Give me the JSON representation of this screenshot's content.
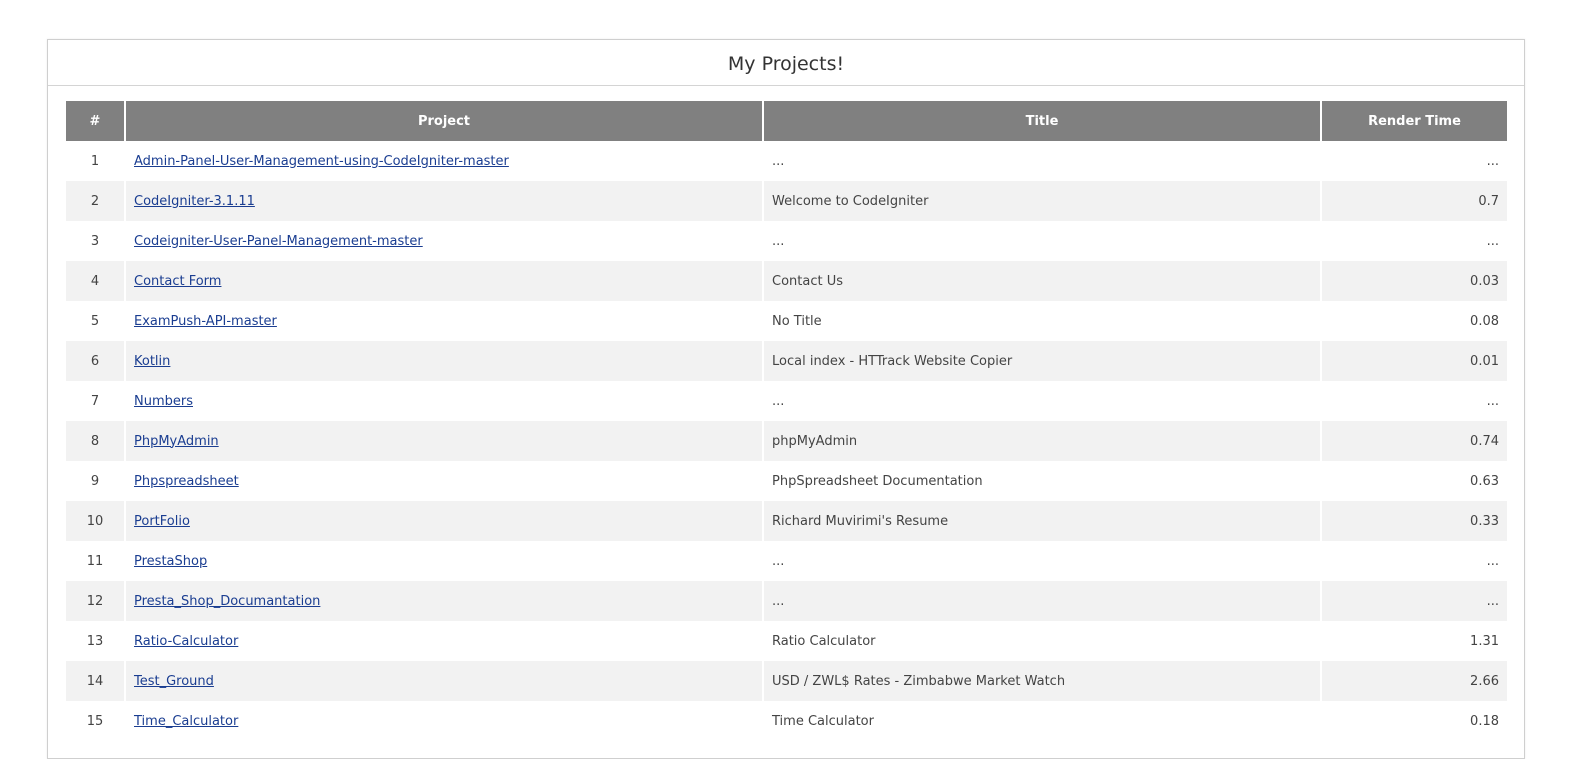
{
  "page": {
    "title": "My Projects!"
  },
  "table": {
    "headers": {
      "num": "#",
      "project": "Project",
      "title": "Title",
      "render_time": "Render Time"
    },
    "rows": [
      {
        "num": "1",
        "project": "Admin-Panel-User-Management-using-CodeIgniter-master",
        "title": "...",
        "render_time": "..."
      },
      {
        "num": "2",
        "project": "CodeIgniter-3.1.11",
        "title": "Welcome to CodeIgniter",
        "render_time": "0.7"
      },
      {
        "num": "3",
        "project": "Codeigniter-User-Panel-Management-master",
        "title": "...",
        "render_time": "..."
      },
      {
        "num": "4",
        "project": "Contact Form",
        "title": "Contact Us",
        "render_time": "0.03"
      },
      {
        "num": "5",
        "project": "ExamPush-API-master",
        "title": "No Title",
        "render_time": "0.08"
      },
      {
        "num": "6",
        "project": "Kotlin",
        "title": "Local index - HTTrack Website Copier",
        "render_time": "0.01"
      },
      {
        "num": "7",
        "project": "Numbers",
        "title": "...",
        "render_time": "..."
      },
      {
        "num": "8",
        "project": "PhpMyAdmin",
        "title": "phpMyAdmin",
        "render_time": "0.74"
      },
      {
        "num": "9",
        "project": "Phpspreadsheet",
        "title": "PhpSpreadsheet Documentation",
        "render_time": "0.63"
      },
      {
        "num": "10",
        "project": "PortFolio",
        "title": "Richard Muvirimi's Resume",
        "render_time": "0.33"
      },
      {
        "num": "11",
        "project": "PrestaShop",
        "title": "...",
        "render_time": "..."
      },
      {
        "num": "12",
        "project": "Presta_Shop_Documantation",
        "title": "...",
        "render_time": "..."
      },
      {
        "num": "13",
        "project": "Ratio-Calculator",
        "title": "Ratio Calculator",
        "render_time": "1.31"
      },
      {
        "num": "14",
        "project": "Test_Ground",
        "title": "USD / ZWL$ Rates - Zimbabwe Market Watch",
        "render_time": "2.66"
      },
      {
        "num": "15",
        "project": "Time_Calculator",
        "title": "Time Calculator",
        "render_time": "0.18"
      }
    ]
  },
  "colors": {
    "header_bg": "#808080",
    "header_text": "#ffffff",
    "row_alt_bg": "#f2f2f2",
    "link": "#1a3d91"
  }
}
